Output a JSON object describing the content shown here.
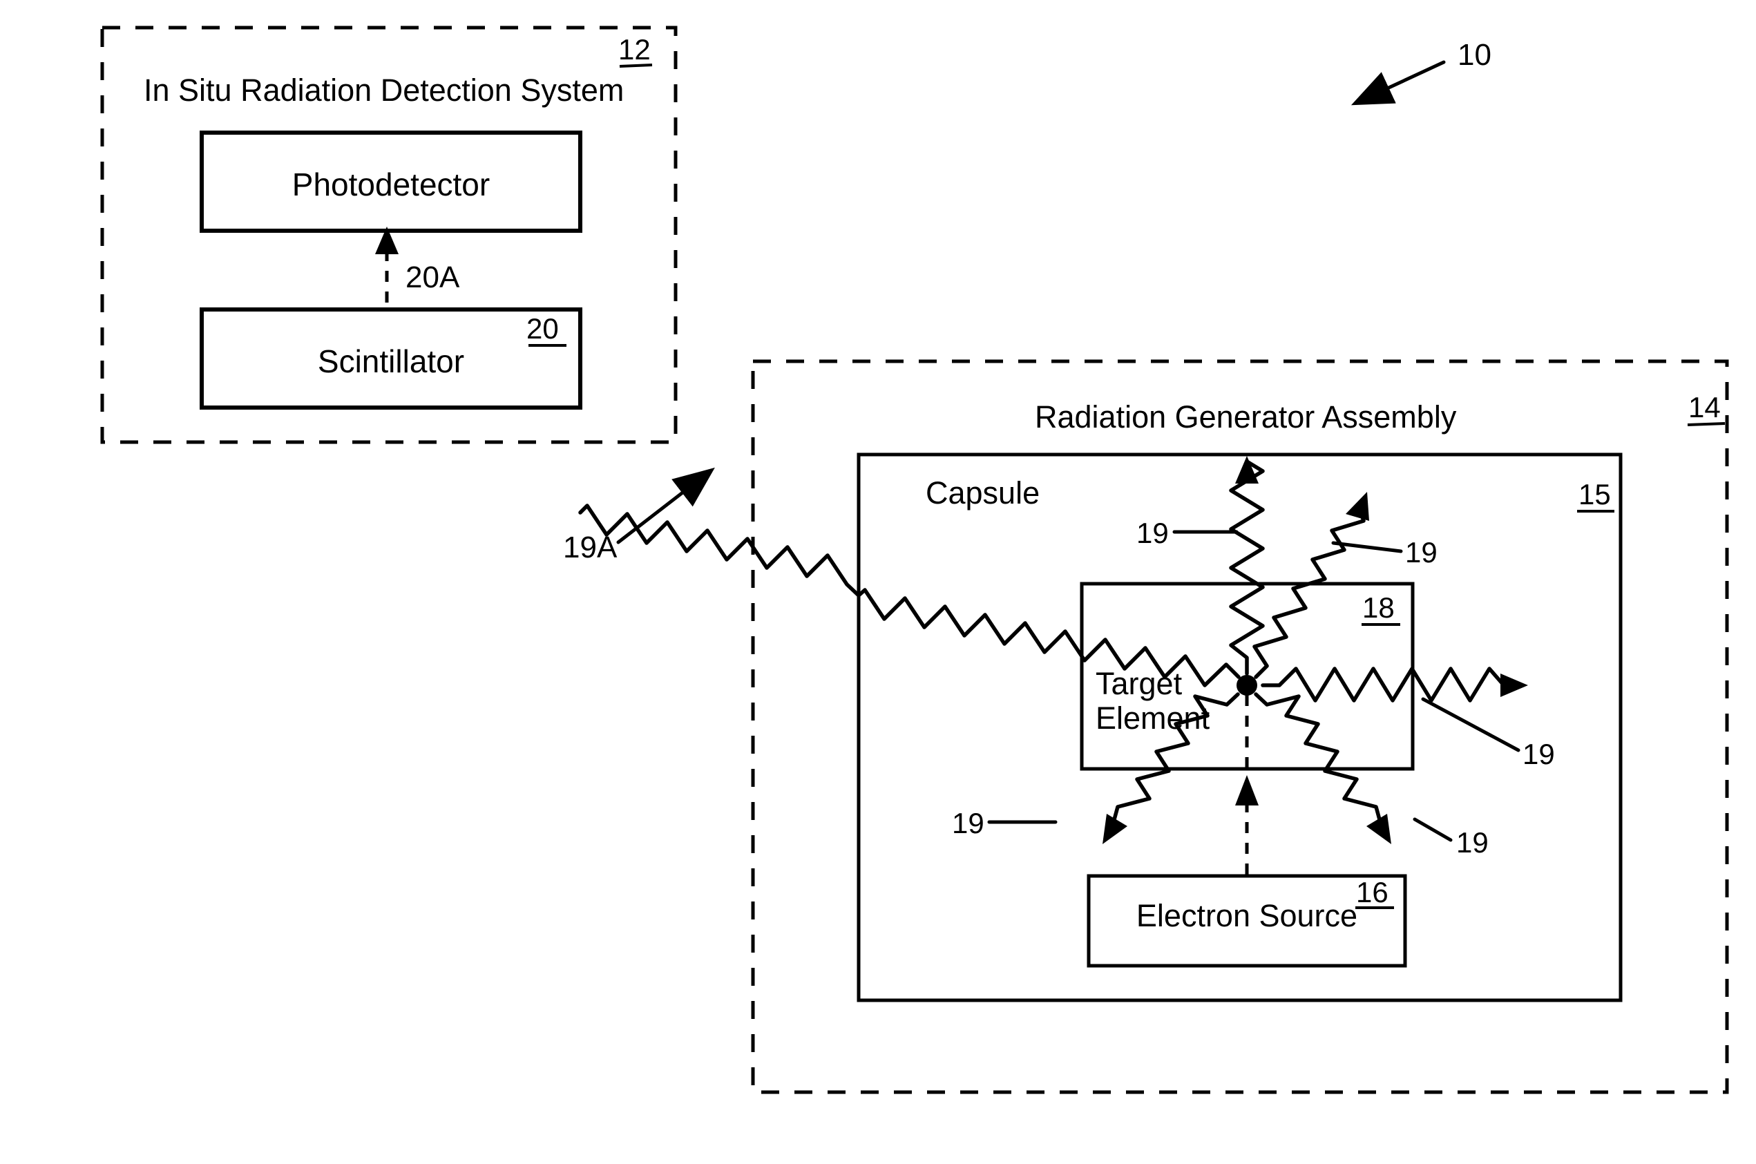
{
  "figure": {
    "reference_label": "10",
    "detection_system": {
      "title": "In Situ Radiation Detection System",
      "ref": "12",
      "photodetector": {
        "label": "Photodetector"
      },
      "scintillator": {
        "label": "Scintillator",
        "ref": "20"
      },
      "signal_path_label": "20A"
    },
    "radiation_path_label": "19A",
    "generator_assembly": {
      "title": "Radiation Generator Assembly",
      "ref": "14",
      "capsule": {
        "label": "Capsule",
        "ref": "15"
      },
      "target_element": {
        "label_line1": "Target",
        "label_line2": "Element",
        "ref": "18"
      },
      "electron_source": {
        "label": "Electron Source",
        "ref": "16"
      },
      "radiation_refs": {
        "top_left": "19",
        "top_right": "19",
        "right": "19",
        "bottom_left": "19",
        "bottom_right": "19"
      }
    }
  }
}
